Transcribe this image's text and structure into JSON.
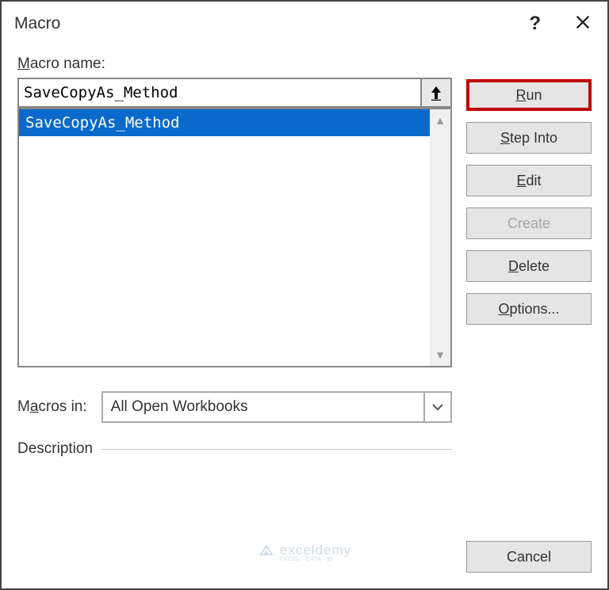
{
  "title": "Macro",
  "labels": {
    "macro_name": "Macro name:",
    "macros_in": "Macros in:",
    "description": "Description"
  },
  "macro_name_input": "SaveCopyAs_Method",
  "macro_list": {
    "items": [
      "SaveCopyAs_Method"
    ],
    "selected": "SaveCopyAs_Method"
  },
  "macros_in_value": "All Open Workbooks",
  "buttons": {
    "run": "Run",
    "step_into": "Step Into",
    "edit": "Edit",
    "create": "Create",
    "delete": "Delete",
    "options": "Options...",
    "cancel": "Cancel"
  },
  "watermark": {
    "main": "exceldemy",
    "sub": "EXCEL · DATA · BI"
  }
}
